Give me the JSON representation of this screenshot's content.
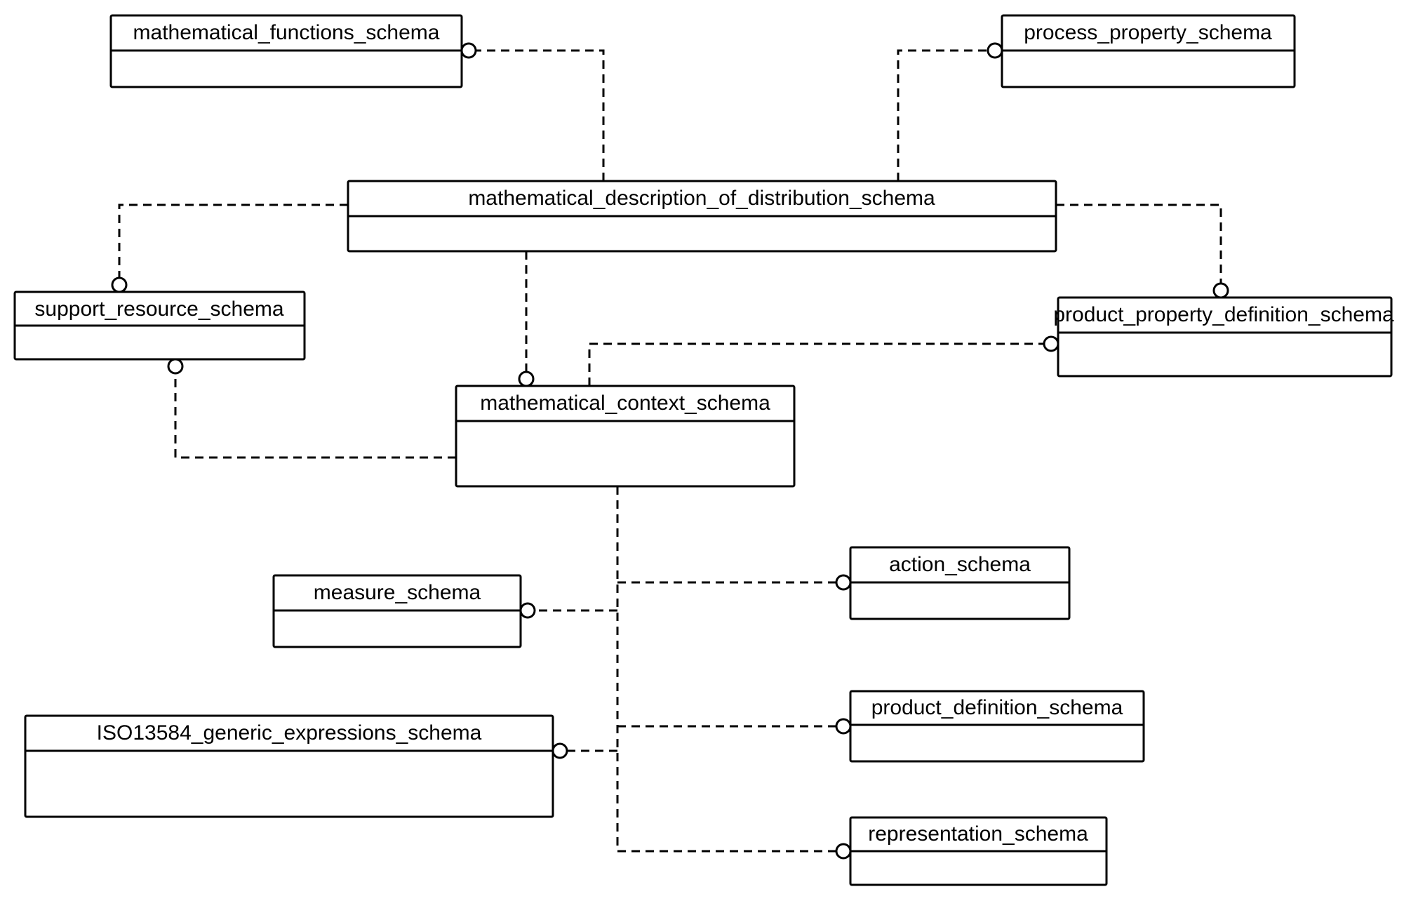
{
  "diagram": {
    "type": "schema-dependency-diagram",
    "notation": "EXPRESS-G",
    "boxes": {
      "mathematical_functions": {
        "label": "mathematical_functions_schema"
      },
      "process_property": {
        "label": "process_property_schema"
      },
      "math_desc_dist": {
        "label": "mathematical_description_of_distribution_schema"
      },
      "support_resource": {
        "label": "support_resource_schema"
      },
      "product_property_def": {
        "label": "product_property_definition_schema"
      },
      "math_context": {
        "label": "mathematical_context_schema"
      },
      "measure": {
        "label": "measure_schema"
      },
      "action": {
        "label": "action_schema"
      },
      "iso13584_generic_expr": {
        "label": "ISO13584_generic_expressions_schema"
      },
      "product_definition": {
        "label": "product_definition_schema"
      },
      "representation": {
        "label": "representation_schema"
      }
    },
    "edges": [
      {
        "from": "math_desc_dist",
        "to": "mathematical_functions"
      },
      {
        "from": "math_desc_dist",
        "to": "process_property"
      },
      {
        "from": "math_desc_dist",
        "to": "support_resource"
      },
      {
        "from": "math_desc_dist",
        "to": "product_property_def"
      },
      {
        "from": "math_desc_dist",
        "to": "math_context"
      },
      {
        "from": "math_context",
        "to": "support_resource"
      },
      {
        "from": "math_context",
        "to": "product_property_def"
      },
      {
        "from": "math_context",
        "to": "measure"
      },
      {
        "from": "math_context",
        "to": "action"
      },
      {
        "from": "math_context",
        "to": "iso13584_generic_expr"
      },
      {
        "from": "math_context",
        "to": "product_definition"
      },
      {
        "from": "math_context",
        "to": "representation"
      }
    ]
  }
}
